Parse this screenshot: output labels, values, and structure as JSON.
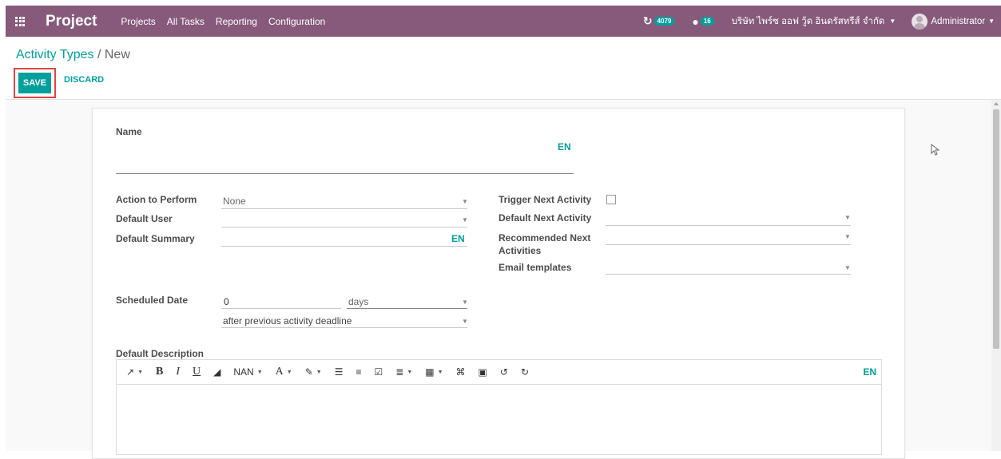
{
  "navbar": {
    "app_name": "Project",
    "menu": [
      "Projects",
      "All Tasks",
      "Reporting",
      "Configuration"
    ],
    "activity_count": "4079",
    "message_count": "16",
    "company": "บริษัท ไพร์ซ ออฟ วู้ด อินดรัสทรีส์ จำกัด",
    "user": "Administrator",
    "color": "#875a7b"
  },
  "breadcrumb": {
    "parent": "Activity Types",
    "separator": "/",
    "current": "New"
  },
  "buttons": {
    "save": "SAVE",
    "discard": "DISCARD",
    "accent": "#00a09d"
  },
  "form": {
    "name_label": "Name",
    "lang_code": "EN",
    "left_fields": [
      {
        "label": "Action to Perform",
        "value": "None"
      },
      {
        "label": "Default User",
        "value": ""
      },
      {
        "label": "Default Summary",
        "value": ""
      }
    ],
    "right_fields": [
      {
        "label": "Trigger Next Activity",
        "checked": false
      },
      {
        "label": "Default Next Activity",
        "value": ""
      },
      {
        "label": "Recommended Next Activities",
        "value": ""
      },
      {
        "label": "Email templates",
        "value": ""
      }
    ],
    "scheduled_date": {
      "label": "Scheduled Date",
      "number": "0",
      "unit": "days",
      "relative": "after previous activity deadline"
    },
    "description": {
      "label": "Default Description"
    }
  },
  "editor_toolbar": {
    "font_size": "NAN",
    "icons": [
      "magic-wand-icon",
      "bold-icon",
      "italic-icon",
      "underline-icon",
      "eraser-icon",
      "font-color-icon",
      "highlight-icon",
      "bullet-list-icon",
      "numbered-list-icon",
      "checklist-icon",
      "align-icon",
      "table-icon",
      "link-icon",
      "image-icon",
      "undo-icon",
      "redo-icon"
    ],
    "bold": "B",
    "italic": "I",
    "underline": "U",
    "font_color": "A"
  }
}
